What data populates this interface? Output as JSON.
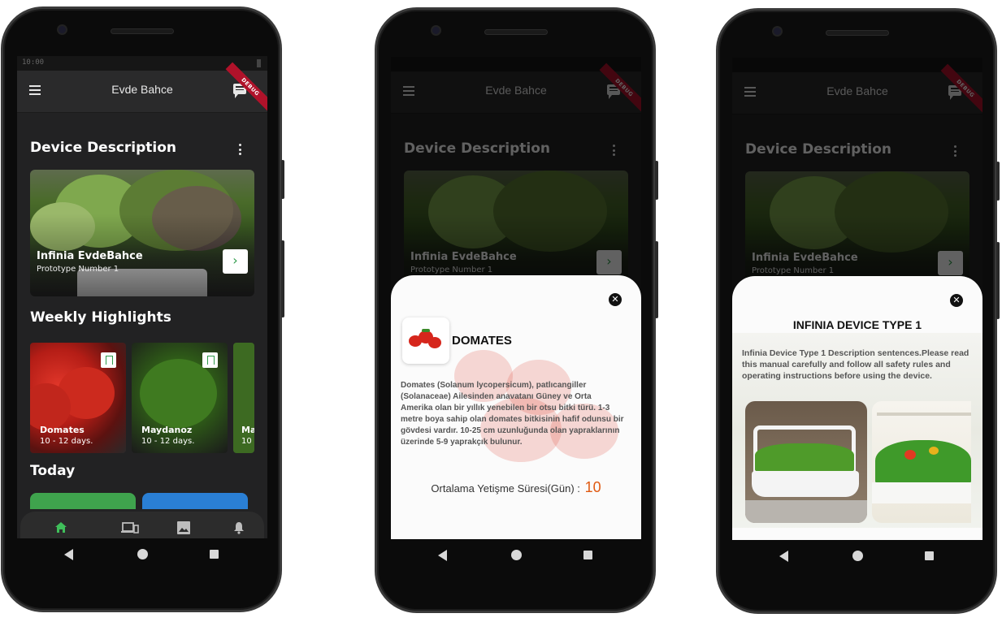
{
  "app": {
    "title": "Evde Bahce",
    "debug_label": "DEBUG",
    "status_time": "10:00"
  },
  "home": {
    "section_description": "Device Description",
    "hero": {
      "name": "Infinia EvdeBahce",
      "subtitle": "Prototype Number 1",
      "button_icon": "›"
    },
    "section_highlights": "Weekly Highlights",
    "highlights": [
      {
        "name": "Domates",
        "days": "10 - 12 days."
      },
      {
        "name": "Maydanoz",
        "days": "10 - 12 days."
      },
      {
        "name": "Ma",
        "days": "10"
      }
    ],
    "section_today": "Today",
    "today_colors": [
      "#3fa34d",
      "#2a7fd4"
    ],
    "bottom_nav": [
      "home-icon",
      "devices-icon",
      "image-icon",
      "bell-icon"
    ],
    "active_color": "#3fbf5a"
  },
  "plant_sheet": {
    "close_icon": "✕",
    "title": "DOMATES",
    "description": "Domates (Solanum lycopersicum), patlıcangiller (Solanaceae) Ailesinden anavatanı Güney ve Orta Amerika olan bir yıllık yenebilen bir otsu bitki türü. 1-3 metre boya sahip olan domates bitkisinin hafif odunsu bir gövdesi vardır. 10-25 cm uzunluğunda olan yapraklarının üzerinde 5-9 yaprakçık bulunur.",
    "avg_label": "Ortalama Yetişme Süresi(Gün) :",
    "avg_value": "10"
  },
  "device_sheet": {
    "close_icon": "✕",
    "title": "INFINIA DEVICE TYPE 1",
    "description": "Infinia Device Type 1 Description sentences.Please read this manual carefully and follow all safety rules and operating instructions before using the device."
  }
}
